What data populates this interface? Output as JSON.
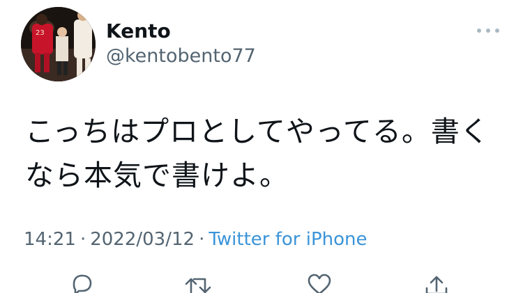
{
  "user": {
    "display_name": "Kento",
    "handle": "@kentobento77",
    "avatar": "avatar-photo"
  },
  "tweet": {
    "text": "こっちはプロとしてやってる。書く\nなら本気で書けよ。",
    "time": "14:21",
    "separator": "·",
    "date": "2022/03/12",
    "source": "Twitter for iPhone"
  },
  "icons": {
    "more": "more-icon",
    "reply": "reply-icon",
    "retweet": "retweet-icon",
    "like": "like-icon",
    "share": "share-icon"
  },
  "colors": {
    "text": "#0f1419",
    "secondary": "#536471",
    "link": "#3b94d9",
    "icon": "#536471"
  }
}
